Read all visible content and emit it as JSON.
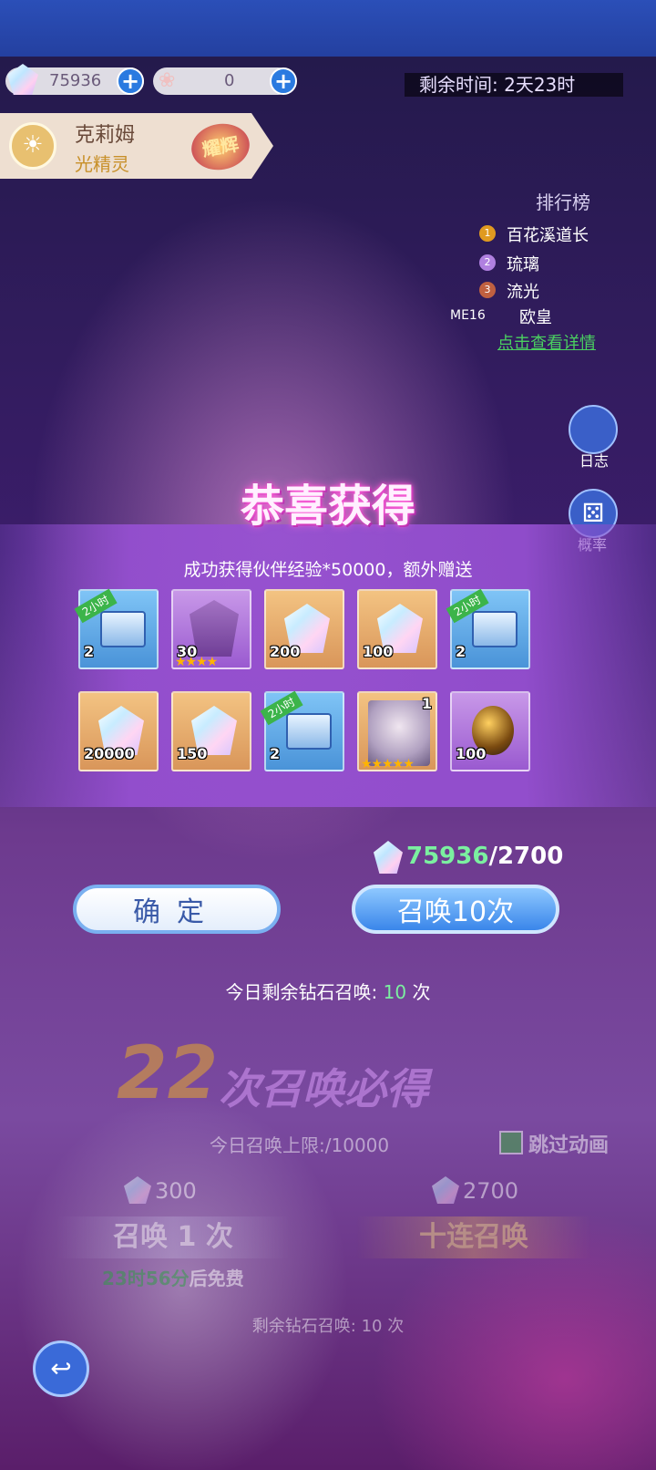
{
  "resources": {
    "diamonds": "75936",
    "flowers": "0"
  },
  "timer": {
    "label": "剩余时间:",
    "value": "2天23时"
  },
  "character": {
    "name": "克莉姆",
    "class": "光精灵",
    "badge": "耀辉"
  },
  "ranking": {
    "title": "排行榜",
    "entries": [
      {
        "rank": "1",
        "name": "百花溪道长"
      },
      {
        "rank": "2",
        "name": "琉璃"
      },
      {
        "rank": "3",
        "name": "流光"
      }
    ],
    "me_label": "ME16",
    "me_name": "欧皇",
    "details_link": "点击查看详情"
  },
  "side_buttons": {
    "log": "日志",
    "rate": "概率"
  },
  "popup": {
    "title": "恭喜获得",
    "message": "成功获得伙伴经验*50000，额外赠送",
    "items": [
      {
        "type": "chest",
        "bg": "blue",
        "tag": "2小时",
        "qty": "2"
      },
      {
        "type": "shard",
        "bg": "purple",
        "qty": "30",
        "stars": "★★★★"
      },
      {
        "type": "crystal",
        "bg": "gold",
        "qty": "200"
      },
      {
        "type": "crystal",
        "bg": "gold",
        "qty": "100"
      },
      {
        "type": "chest",
        "bg": "blue",
        "tag": "2小时",
        "qty": "2"
      },
      {
        "type": "crystal",
        "bg": "gold",
        "qty": "20000"
      },
      {
        "type": "crystal",
        "bg": "gold",
        "qty": "150"
      },
      {
        "type": "chest",
        "bg": "blue",
        "tag": "2小时",
        "qty": "2"
      },
      {
        "type": "portrait",
        "bg": "gold",
        "qty": "1",
        "stars": "★★★★★"
      },
      {
        "type": "egg",
        "bg": "purple",
        "qty": "100"
      }
    ],
    "cost_current": "75936",
    "cost_total": "/2700",
    "confirm_label": "确定",
    "summon_label": "召唤10次",
    "today_prefix": "今日剩余钻石召唤:",
    "today_count": "10",
    "today_suffix": "次"
  },
  "background": {
    "pity_num": "22",
    "pity_text": "次召唤必得",
    "limit_prefix": "今日召唤上限:",
    "limit_value": "/10000",
    "skip_label": "跳过动画",
    "single_cost": "300",
    "multi_cost": "2700",
    "single_label": "召唤 1 次",
    "multi_label": "十连召唤",
    "free_time": "23时56分",
    "free_suffix": "后免费",
    "remain_prefix": "剩余钻石召唤:",
    "remain_count": "10",
    "remain_suffix": "次"
  },
  "colors": {
    "accent_blue": "#3a86ea",
    "popup_purple": "#9650d2",
    "highlight_green": "#7bf0a0"
  }
}
